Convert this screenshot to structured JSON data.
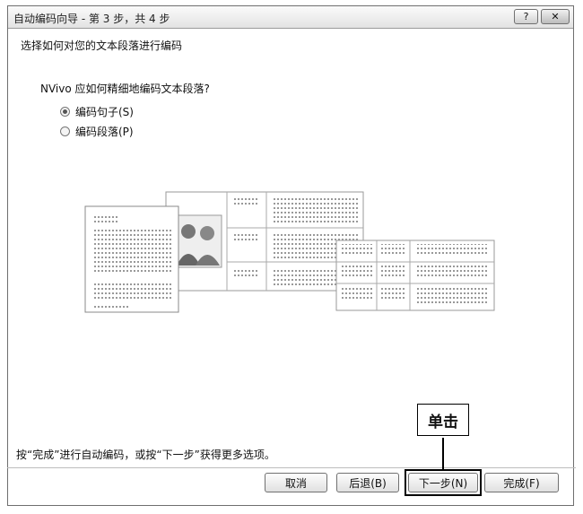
{
  "window": {
    "title": "自动编码向导 - 第 3 步，共 4 步",
    "help_button": "?",
    "close_button": "✕"
  },
  "page": {
    "header": "选择如何对您的文本段落进行编码",
    "question": "NVivo 应如何精细地编码文本段落?",
    "options": [
      {
        "label": "编码句子(S)",
        "selected": true
      },
      {
        "label": "编码段落(P)",
        "selected": false
      }
    ],
    "footer_hint": "按“完成”进行自动编码，或按“下一步”获得更多选项。"
  },
  "buttons": {
    "cancel": "取消",
    "back": "后退(B)",
    "next": "下一步(N)",
    "finish": "完成(F)"
  },
  "annotation": {
    "callout": "单击"
  }
}
